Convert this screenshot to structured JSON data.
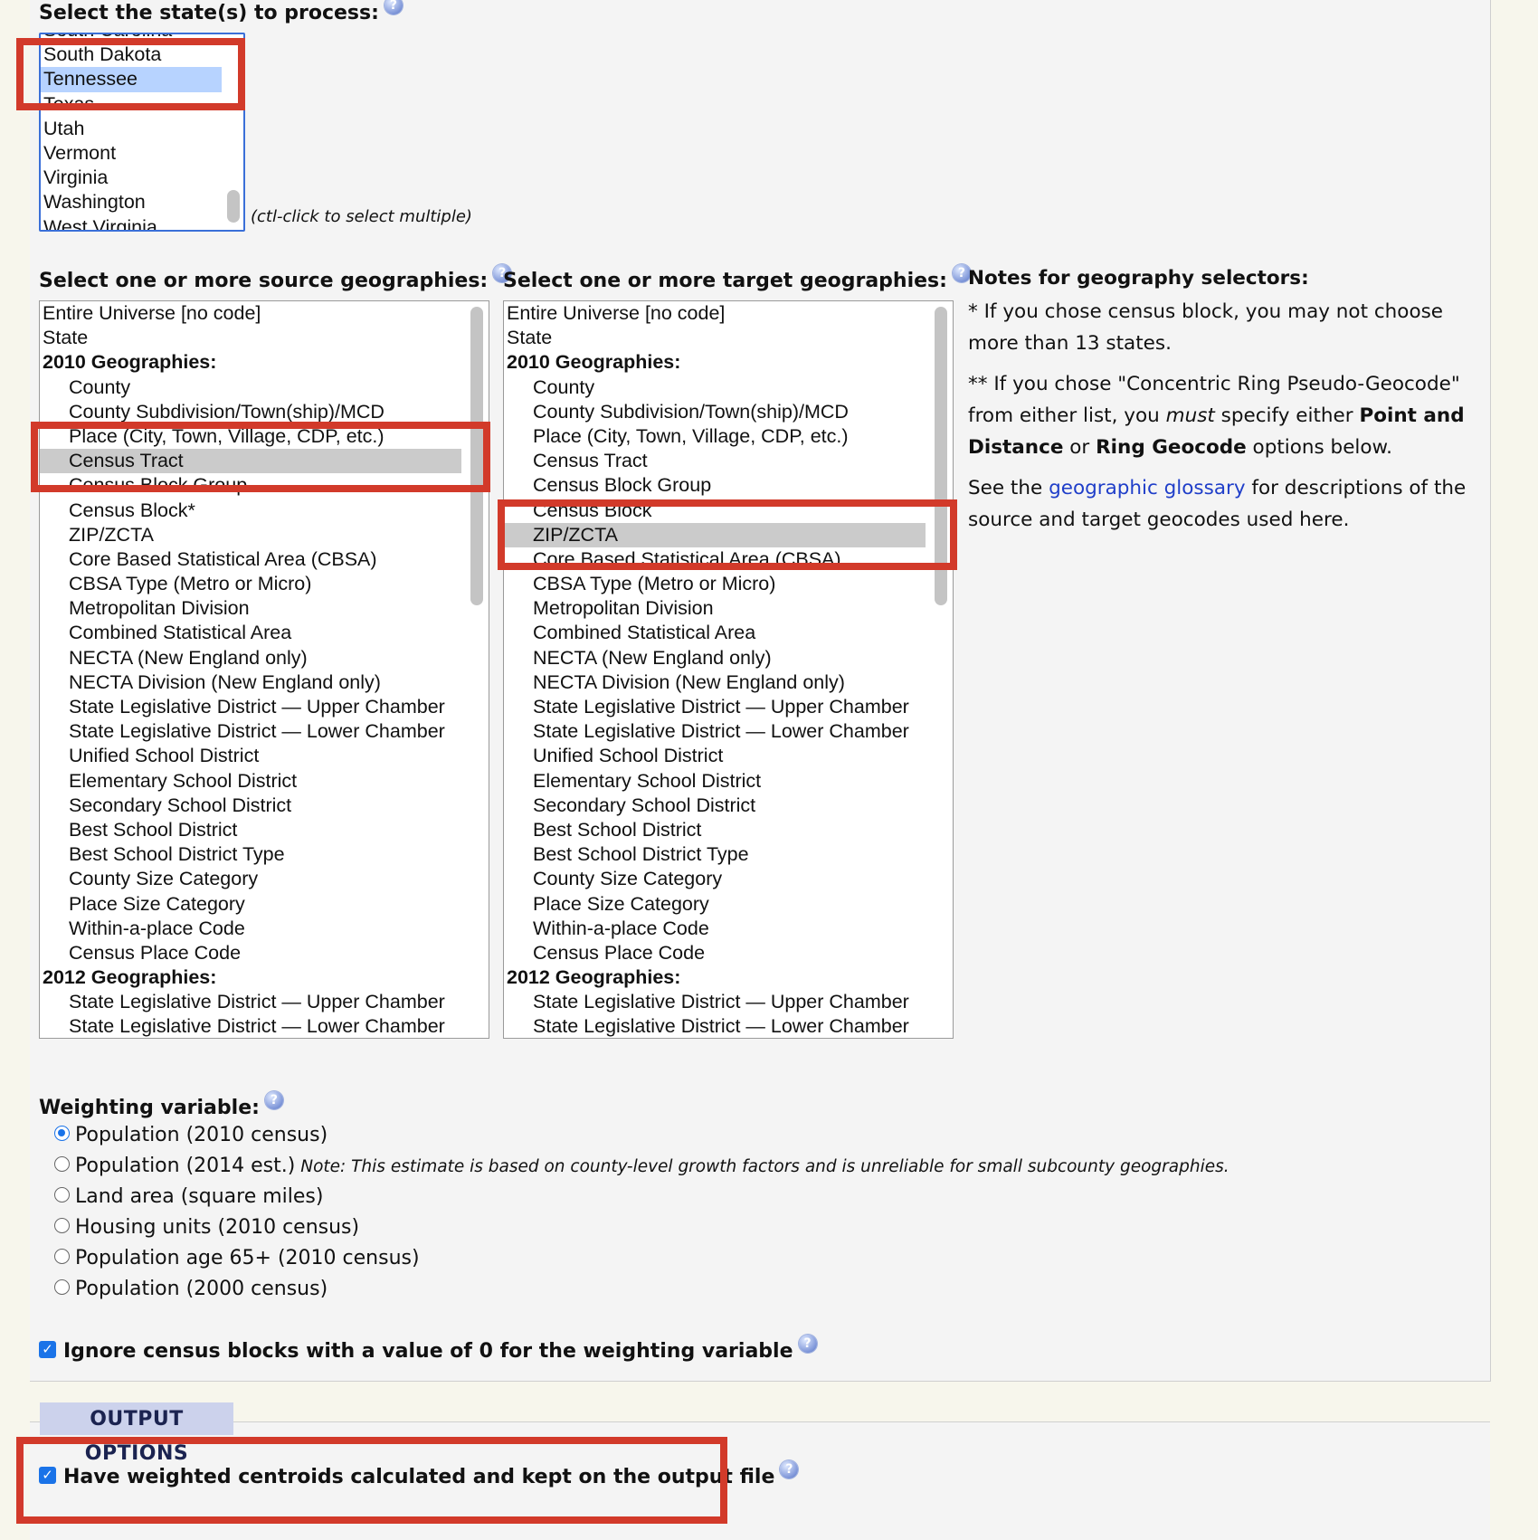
{
  "states": {
    "label": "Select the state(s) to process:",
    "options": [
      "South Carolina",
      "South Dakota",
      "Tennessee",
      "Texas",
      "Utah",
      "Vermont",
      "Virginia",
      "Washington",
      "West Virginia"
    ],
    "selected": "Tennessee",
    "hint": "(ctl-click to select multiple)"
  },
  "source": {
    "label": "Select one or more source geographies:",
    "selected": "Census Tract",
    "options": [
      {
        "text": "Entire Universe [no code]"
      },
      {
        "text": "State"
      },
      {
        "text": "2010 Geographies:",
        "group": true
      },
      {
        "text": "County",
        "indent": true
      },
      {
        "text": "County Subdivision/Town(ship)/MCD",
        "indent": true
      },
      {
        "text": "Place (City, Town, Village, CDP, etc.)",
        "indent": true
      },
      {
        "text": "Census Tract",
        "indent": true
      },
      {
        "text": "Census Block Group",
        "indent": true
      },
      {
        "text": "Census Block*",
        "indent": true
      },
      {
        "text": "ZIP/ZCTA",
        "indent": true
      },
      {
        "text": "Core Based Statistical Area (CBSA)",
        "indent": true
      },
      {
        "text": "CBSA Type (Metro or Micro)",
        "indent": true
      },
      {
        "text": "Metropolitan Division",
        "indent": true
      },
      {
        "text": "Combined Statistical Area",
        "indent": true
      },
      {
        "text": "NECTA (New England only)",
        "indent": true
      },
      {
        "text": "NECTA Division (New England only)",
        "indent": true
      },
      {
        "text": "State Legislative District — Upper Chamber",
        "indent": true
      },
      {
        "text": "State Legislative District — Lower Chamber",
        "indent": true
      },
      {
        "text": "Unified School District",
        "indent": true
      },
      {
        "text": "Elementary School District",
        "indent": true
      },
      {
        "text": "Secondary School District",
        "indent": true
      },
      {
        "text": "Best School District",
        "indent": true
      },
      {
        "text": "Best School District Type",
        "indent": true
      },
      {
        "text": "County Size Category",
        "indent": true
      },
      {
        "text": "Place Size Category",
        "indent": true
      },
      {
        "text": "Within-a-place Code",
        "indent": true
      },
      {
        "text": "Census Place Code",
        "indent": true
      },
      {
        "text": "2012 Geographies:",
        "group": true
      },
      {
        "text": "State Legislative District — Upper Chamber",
        "indent": true
      },
      {
        "text": "State Legislative District — Lower Chamber",
        "indent": true
      }
    ]
  },
  "target": {
    "label": "Select one or more target geographies:",
    "selected": "ZIP/ZCTA",
    "options": [
      {
        "text": "Entire Universe [no code]"
      },
      {
        "text": "State"
      },
      {
        "text": "2010 Geographies:",
        "group": true
      },
      {
        "text": "County",
        "indent": true
      },
      {
        "text": "County Subdivision/Town(ship)/MCD",
        "indent": true
      },
      {
        "text": "Place (City, Town, Village, CDP, etc.)",
        "indent": true
      },
      {
        "text": "Census Tract",
        "indent": true
      },
      {
        "text": "Census Block Group",
        "indent": true
      },
      {
        "text": "Census Block",
        "indent": true
      },
      {
        "text": "ZIP/ZCTA",
        "indent": true
      },
      {
        "text": "Core Based Statistical Area (CBSA)",
        "indent": true
      },
      {
        "text": "CBSA Type (Metro or Micro)",
        "indent": true
      },
      {
        "text": "Metropolitan Division",
        "indent": true
      },
      {
        "text": "Combined Statistical Area",
        "indent": true
      },
      {
        "text": "NECTA (New England only)",
        "indent": true
      },
      {
        "text": "NECTA Division (New England only)",
        "indent": true
      },
      {
        "text": "State Legislative District — Upper Chamber",
        "indent": true
      },
      {
        "text": "State Legislative District — Lower Chamber",
        "indent": true
      },
      {
        "text": "Unified School District",
        "indent": true
      },
      {
        "text": "Elementary School District",
        "indent": true
      },
      {
        "text": "Secondary School District",
        "indent": true
      },
      {
        "text": "Best School District",
        "indent": true
      },
      {
        "text": "Best School District Type",
        "indent": true
      },
      {
        "text": "County Size Category",
        "indent": true
      },
      {
        "text": "Place Size Category",
        "indent": true
      },
      {
        "text": "Within-a-place Code",
        "indent": true
      },
      {
        "text": "Census Place Code",
        "indent": true
      },
      {
        "text": "2012 Geographies:",
        "group": true
      },
      {
        "text": "State Legislative District — Upper Chamber",
        "indent": true
      },
      {
        "text": "State Legislative District — Lower Chamber",
        "indent": true
      }
    ]
  },
  "notes": {
    "title": "Notes for geography selectors:",
    "note1": "* If you chose census block, you may not choose more than 13 states.",
    "note2_a": "** If you chose \"Concentric Ring Pseudo-Geocode\" from either list, you ",
    "note2_must": "must",
    "note2_b": " specify either ",
    "note2_pd": "Point and Distance",
    "note2_c": " or ",
    "note2_rg": "Ring Geocode",
    "note2_d": " options below.",
    "note3_a": "See the ",
    "note3_link": "geographic glossary",
    "note3_b": " for descriptions of the source and target geocodes used here."
  },
  "weighting": {
    "label": "Weighting variable:",
    "options": [
      {
        "label": "Population (2010 census)",
        "checked": true
      },
      {
        "label": "Population (2014 est.)",
        "note": "Note: This estimate is based on county-level growth factors and is unreliable for small subcounty geographies."
      },
      {
        "label": "Land area (square miles)"
      },
      {
        "label": "Housing units (2010 census)"
      },
      {
        "label": "Population age 65+ (2010 census)"
      },
      {
        "label": "Population (2000 census)"
      }
    ],
    "ignore_zero": "Ignore census blocks with a value of 0 for the weighting variable"
  },
  "output": {
    "tab": "OUTPUT OPTIONS",
    "centroids": "Have weighted centroids calculated and kept on the output file"
  },
  "icons": {
    "help": "help-icon",
    "checkbox": "checkbox-checked-icon"
  },
  "colors": {
    "annotation": "#d23a2a",
    "link": "#1f3ec9",
    "checkbox": "#1a73e8",
    "state_selection": "#b7d3ff",
    "geo_selection": "#cbcbcb"
  }
}
